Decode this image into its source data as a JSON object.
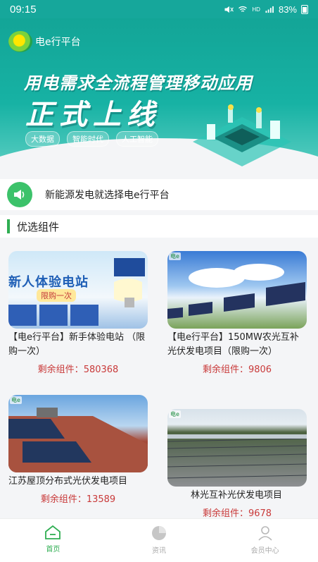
{
  "status": {
    "time": "09:15",
    "battery": "83%",
    "net": "HD"
  },
  "brand": {
    "name": "电e行平台",
    "logo_text": "电"
  },
  "banner": {
    "headline": "用电需求全流程管理移动应用",
    "headline2": "正式上线",
    "tags": [
      "大数据",
      "智能时代",
      "人工智能"
    ]
  },
  "notice": {
    "text": "新能源发电就选择电e行平台"
  },
  "section": {
    "title": "优选组件"
  },
  "products": [
    {
      "name": "【电e行平台】新手体验电站 （限购一次）",
      "remain_label": "剩余组件：",
      "remain_value": "580368",
      "banner_text": "新人体验电站",
      "banner_sub": "限购一次",
      "image": "bulb-solar"
    },
    {
      "name": "【电e行平台】150MW农光互补光伏发电项目（限购一次）",
      "remain_label": "剩余组件：",
      "remain_value": "9806",
      "image": "field-solar",
      "logo": "电e"
    },
    {
      "name": "江苏屋顶分布式光伏发电项目",
      "remain_label": "剩余组件：",
      "remain_value": "13589",
      "image": "roof-solar",
      "logo": "电e"
    },
    {
      "name": "林光互补光伏发电项目",
      "remain_label": "剩余组件：",
      "remain_value": "9678",
      "image": "forest-solar",
      "logo": "电e"
    }
  ],
  "tabs": [
    {
      "label": "首页",
      "icon": "home-icon",
      "active": true
    },
    {
      "label": "资讯",
      "icon": "pie-icon",
      "active": false
    },
    {
      "label": "会员中心",
      "icon": "user-icon",
      "active": false
    }
  ],
  "colors": {
    "primary": "#16a79b",
    "accent": "#2fae52",
    "remain": "#c93a3a"
  }
}
